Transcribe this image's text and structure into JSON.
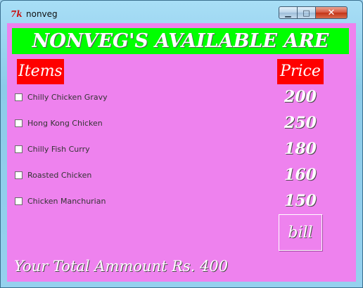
{
  "window": {
    "icon_text": "7k",
    "title": "nonveg",
    "minimize_symbol": "▁",
    "maximize_symbol": "□",
    "close_symbol": "✕"
  },
  "banner": {
    "text": "NONVEG'S AVAILABLE ARE"
  },
  "headers": {
    "items": "Items",
    "price": "Price"
  },
  "menu": [
    {
      "name": "Chilly Chicken Gravy",
      "price": "200",
      "checked": false
    },
    {
      "name": "Hong Kong Chicken",
      "price": "250",
      "checked": false
    },
    {
      "name": "Chilly Fish Curry",
      "price": "180",
      "checked": false
    },
    {
      "name": "Roasted Chicken",
      "price": "160",
      "checked": false
    },
    {
      "name": "Chicken Manchurian",
      "price": "150",
      "checked": false
    }
  ],
  "bill_button": {
    "label": "bill"
  },
  "total": {
    "text": "Your Total Ammount Rs. 400"
  },
  "colors": {
    "background": "#ee82ee",
    "banner": "#00ff00",
    "header": "#ff0000",
    "text": "#ffffff"
  }
}
